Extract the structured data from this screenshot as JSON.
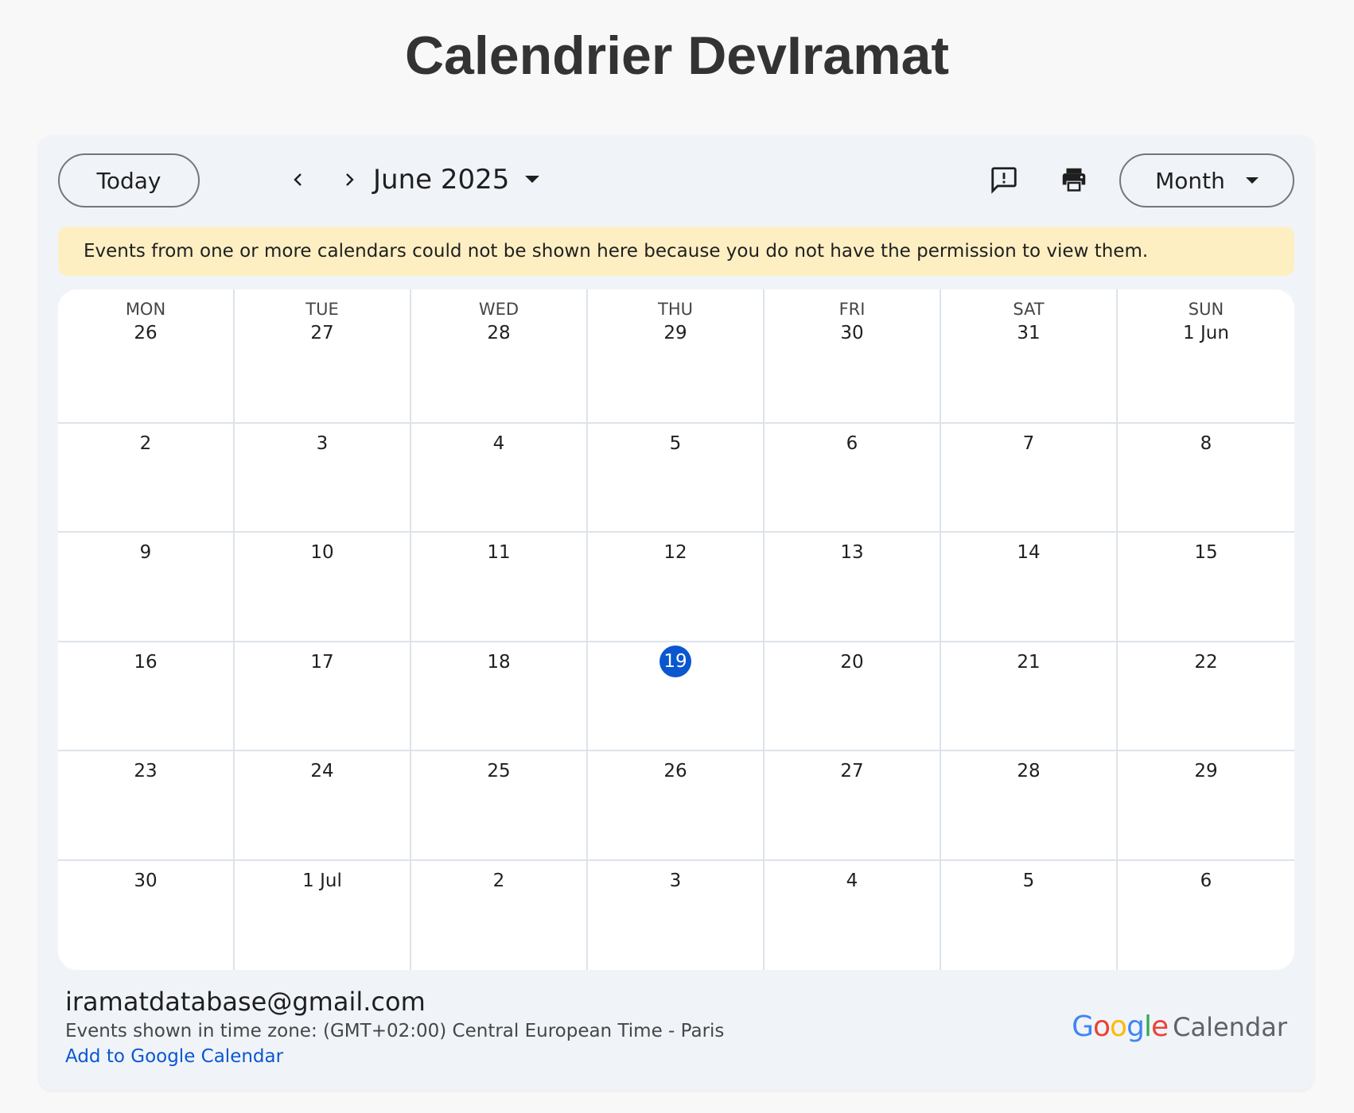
{
  "page": {
    "title": "Calendrier DevIramat"
  },
  "toolbar": {
    "today_label": "Today",
    "month_label": "June 2025",
    "view_label": "Month"
  },
  "warning": {
    "text": "Events from one or more calendars could not be shown here because you do not have the permission to view them."
  },
  "calendar": {
    "weekdays": [
      "MON",
      "TUE",
      "WED",
      "THU",
      "FRI",
      "SAT",
      "SUN"
    ],
    "weeks": [
      [
        "26",
        "27",
        "28",
        "29",
        "30",
        "31",
        "1 Jun"
      ],
      [
        "2",
        "3",
        "4",
        "5",
        "6",
        "7",
        "8"
      ],
      [
        "9",
        "10",
        "11",
        "12",
        "13",
        "14",
        "15"
      ],
      [
        "16",
        "17",
        "18",
        "19",
        "20",
        "21",
        "22"
      ],
      [
        "23",
        "24",
        "25",
        "26",
        "27",
        "28",
        "29"
      ],
      [
        "30",
        "1 Jul",
        "2",
        "3",
        "4",
        "5",
        "6"
      ]
    ],
    "today": "19",
    "today_color": "#0b57d0"
  },
  "footer": {
    "email": "iramatdatabase@gmail.com",
    "timezone_text": "Events shown in time zone: (GMT+02:00) Central European Time - Paris",
    "add_link": "Add to Google Calendar"
  },
  "brand": {
    "google_letters": [
      {
        "ch": "G",
        "color": "#4285f4"
      },
      {
        "ch": "o",
        "color": "#ea4335"
      },
      {
        "ch": "o",
        "color": "#fbbc05"
      },
      {
        "ch": "g",
        "color": "#4285f4"
      },
      {
        "ch": "l",
        "color": "#34a853"
      },
      {
        "ch": "e",
        "color": "#ea4335"
      }
    ],
    "product": "Calendar"
  },
  "icons": {
    "prev": "chevron-left-icon",
    "next": "chevron-right-icon",
    "month_caret": "caret-down-icon",
    "feedback": "feedback-icon",
    "print": "print-icon",
    "view_caret": "caret-down-icon"
  }
}
